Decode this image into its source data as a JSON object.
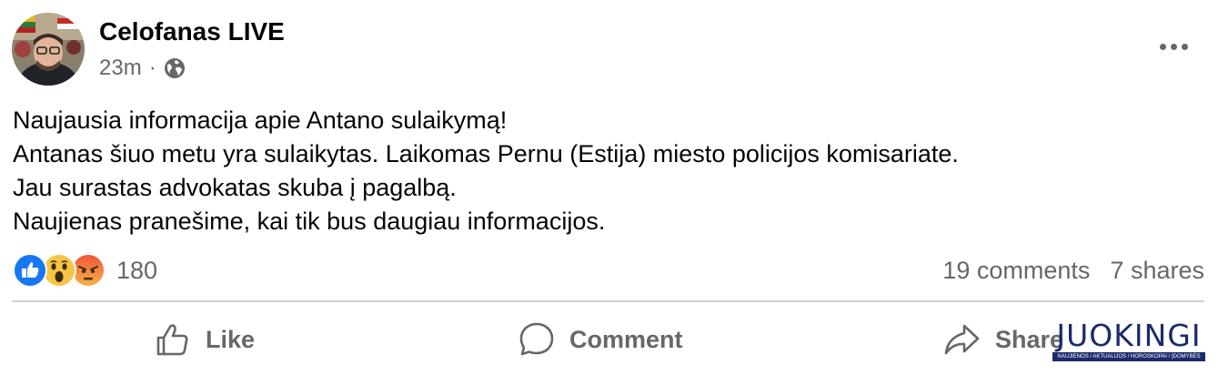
{
  "post": {
    "author": "Celofanas LIVE",
    "time": "23m",
    "separator": "·",
    "privacy_icon": "globe-icon",
    "lines": [
      "Naujausia informacija apie Antano sulaikymą!",
      "Antanas šiuo metu yra sulaikytas. Laikomas Pernu (Estija) miesto policijos komisariate.",
      "Jau surastas advokatas skuba į pagalbą.",
      "Naujienas pranešime, kai tik bus daugiau informacijos."
    ]
  },
  "reactions": {
    "icons": [
      "like-reaction-icon",
      "wow-reaction-icon",
      "angry-reaction-icon"
    ],
    "count": "180"
  },
  "stats": {
    "comments": "19 comments",
    "shares": "7 shares"
  },
  "actions": {
    "like": "Like",
    "comment": "Comment",
    "share": "Share"
  },
  "watermark": {
    "name": "JUOKINGI",
    "tagline": "NAUJIENOS / AKTUALIJOS / HOROSKOPAI / ĮDOMYBĖS"
  },
  "colors": {
    "text": "#050505",
    "secondary": "#65676b",
    "like_blue": "#1877f2",
    "divider": "#ced0d4"
  }
}
